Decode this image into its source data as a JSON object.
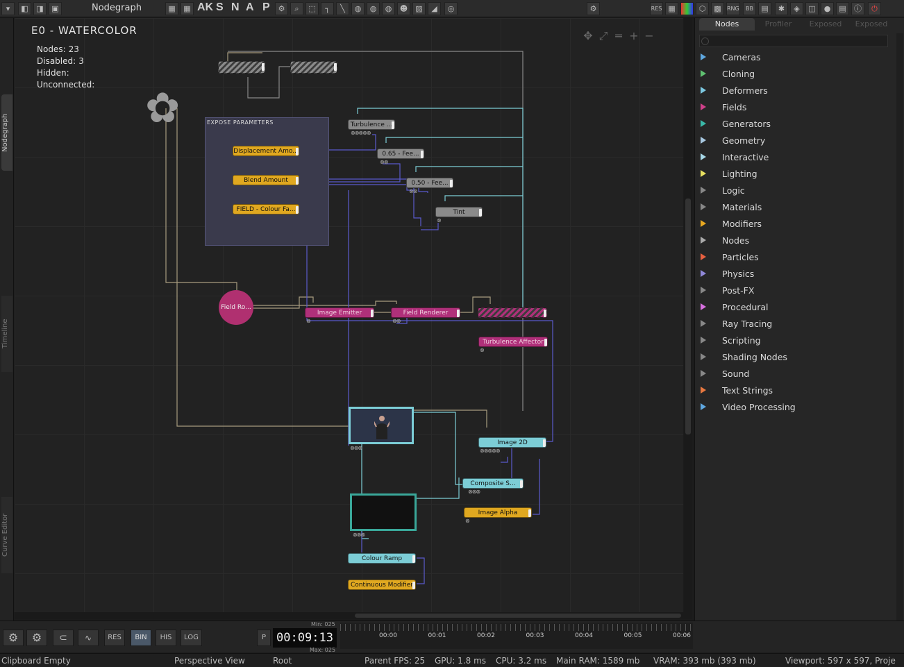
{
  "app": {
    "panel_title": "Nodegraph",
    "toolbar_letters": [
      "AK",
      "S",
      "N",
      "A",
      "P"
    ],
    "toolbar_right": [
      "RES",
      "RNG",
      "BB"
    ]
  },
  "side_tabs": {
    "nodegraph": "Nodegraph",
    "timeline": "Timeline",
    "curve_editor": "Curve Editor"
  },
  "graph": {
    "title": "E0  -  WATERCOLOR",
    "stats": [
      {
        "label": "Nodes:",
        "value": "23"
      },
      {
        "label": "Disabled:",
        "value": "3"
      },
      {
        "label": "Hidden:",
        "value": ""
      },
      {
        "label": "Unconnected:",
        "value": ""
      }
    ],
    "expose_group_title": "EXPOSE PARAMETERS",
    "nodes": {
      "displacement": "Displacement  Amo...",
      "blend": "Blend  Amount",
      "field_colour": "FIELD  -  Colour  Fa...",
      "turbulence_top": "Turbulence  ...",
      "fee065": "0.65  -  Fee...",
      "fee050": "0.50  -  Fee...",
      "tint": "Tint",
      "field_ro": "Field  Ro...",
      "image_emitter": "Image  Emitter",
      "field_renderer": "Field  Renderer",
      "turbulence_affector": "Turbulence  Affector",
      "image_2d": "Image  2D",
      "composite": "Composite  S...",
      "image_alpha": "Image  Alpha",
      "colour_ramp": "Colour  Ramp",
      "continuous_modifier": "Continuous  Modifier"
    }
  },
  "right_panel": {
    "tabs": [
      "Nodes",
      "Profiler",
      "Exposed",
      "Exposed"
    ],
    "categories": [
      {
        "label": "Cameras",
        "color": "#5fa8e0"
      },
      {
        "label": "Cloning",
        "color": "#5fc070"
      },
      {
        "label": "Deformers",
        "color": "#7cc8e0"
      },
      {
        "label": "Fields",
        "color": "#d0408a"
      },
      {
        "label": "Generators",
        "color": "#3ab8a8"
      },
      {
        "label": "Geometry",
        "color": "#a8c8e0"
      },
      {
        "label": "Interactive",
        "color": "#a8d8e8"
      },
      {
        "label": "Lighting",
        "color": "#e8e060"
      },
      {
        "label": "Logic",
        "color": "#888888"
      },
      {
        "label": "Materials",
        "color": "#888888"
      },
      {
        "label": "Modifiers",
        "color": "#e8a820"
      },
      {
        "label": "Nodes",
        "color": "#aaaaaa"
      },
      {
        "label": "Particles",
        "color": "#e86040"
      },
      {
        "label": "Physics",
        "color": "#9088d8"
      },
      {
        "label": "Post-FX",
        "color": "#888888"
      },
      {
        "label": "Procedural",
        "color": "#d870e0"
      },
      {
        "label": "Ray Tracing",
        "color": "#888888"
      },
      {
        "label": "Scripting",
        "color": "#888888"
      },
      {
        "label": "Shading Nodes",
        "color": "#888888"
      },
      {
        "label": "Sound",
        "color": "#888888"
      },
      {
        "label": "Text Strings",
        "color": "#e87840"
      },
      {
        "label": "Video Processing",
        "color": "#5fa8e0"
      }
    ]
  },
  "bottom": {
    "buttons": [
      "RES",
      "BIN",
      "HIS",
      "LOG"
    ],
    "play_label": "P",
    "time": "00:09:13",
    "min_label": "Min: 025",
    "max_label": "Max: 025",
    "ticks": [
      "00:00",
      "00:01",
      "00:02",
      "00:03",
      "00:04",
      "00:05",
      "00:06"
    ]
  },
  "status": {
    "clipboard": "Clipboard Empty",
    "view": "Perspective View",
    "root": "Root",
    "fps": "Parent FPS: 25",
    "gpu": "GPU: 1.8 ms",
    "cpu": "CPU: 3.2 ms",
    "ram": "Main RAM: 1589 mb",
    "vram": "VRAM: 393 mb (393 mb)",
    "viewport": "Viewport: 597 x 597, Proje"
  }
}
